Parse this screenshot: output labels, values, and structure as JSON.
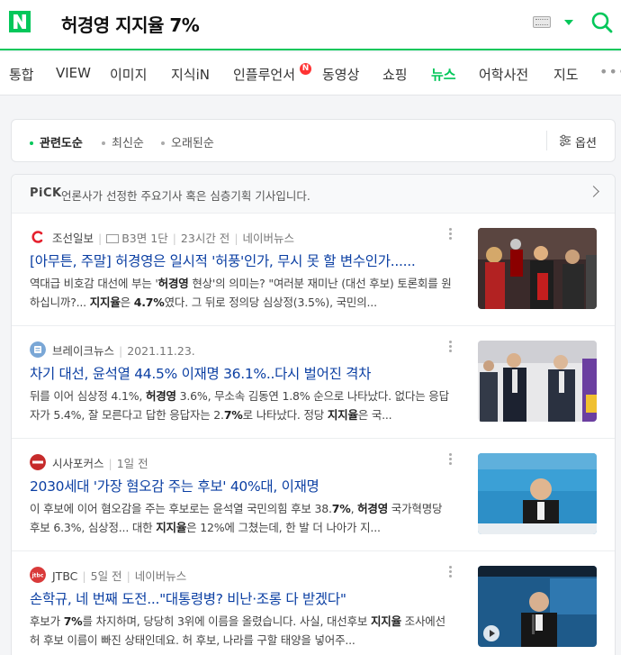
{
  "search": {
    "query": "허경영 지지율 7%"
  },
  "tabs": [
    "통합",
    "VIEW",
    "이미지",
    "지식iN",
    "인플루언서",
    "동영상",
    "쇼핑",
    "뉴스",
    "어학사전",
    "지도"
  ],
  "tab_badge": "N",
  "active_tab": "뉴스",
  "sort": {
    "items": [
      "관련도순",
      "최신순",
      "오래된순"
    ],
    "active": "관련도순",
    "options_label": "옵션"
  },
  "pick": {
    "logo": "PiCK",
    "text": "언론사가 선정한 주요기사 혹은 심층기획 기사입니다."
  },
  "articles": [
    {
      "press": "조선일보",
      "meta2": "B3면 1단",
      "time": "23시간 전",
      "portal": "네이버뉴스",
      "title": "[아무튼, 주말] 허경영은 일시적 '허풍'인가, 무시 못 할 변수인가......",
      "desc_parts": [
        "역대급 비호감 대선에 부는 '",
        "허경영",
        " 현상'의 의미는? \"여러분 재미난 (대선 후보) 토론회를 원하십니까?... ",
        "지지율",
        "은 ",
        "4.7%",
        "였다. 그 뒤로 정의당 심상정(3.5%), 국민의..."
      ],
      "icon_color": "#e5212e"
    },
    {
      "press": "브레이크뉴스",
      "time": "2021.11.23.",
      "title": "차기 대선, 윤석열 44.5% 이재명 36.1%..다시 벌어진 격차",
      "desc_parts": [
        "뒤를 이어 심상정 4.1%, ",
        "허경영",
        " 3.6%, 무소속 김동연 1.8% 순으로 나타났다. 없다는 응답자가 5.4%, 잘 모른다고 답한 응답자는 2.",
        "7%",
        "로 나타났다. 정당 ",
        "지지율",
        "은 국..."
      ],
      "icon_color": "#7aa7d6"
    },
    {
      "press": "시사포커스",
      "time": "1일 전",
      "title": "2030세대 '가장 혐오감 주는 후보' 40%대, 이재명",
      "desc_parts": [
        "이 후보에 이어 혐오감을 주는 후보로는 윤석열 국민의힘 후보 38.",
        "7%",
        ", ",
        "허경영",
        " 국가혁명당 후보 6.3%, 심상정... 대한 ",
        "지지율",
        "은 12%에 그쳤는데, 한 발 더 나아가 지..."
      ],
      "icon_color": "#c62b2b"
    },
    {
      "press": "JTBC",
      "time": "5일 전",
      "portal": "네이버뉴스",
      "title": "손학규, 네 번째 도전...\"대통령병? 비난·조롱 다 받겠다\"",
      "desc_parts": [
        "후보가 ",
        "7%",
        "를 차지하며, 당당히 3위에 이름을 올렸습니다. 사실, 대선후보 ",
        "지지율",
        " 조사에선 허 후보 이름이 빠진 상태인데요. 허 후보, 나라를 구할 태양을 넣어주..."
      ],
      "icon_color": "#d93a3a",
      "icon_text": "jtbc"
    }
  ],
  "colors": {
    "brand": "#03c75a",
    "title": "#0b3fa3"
  }
}
